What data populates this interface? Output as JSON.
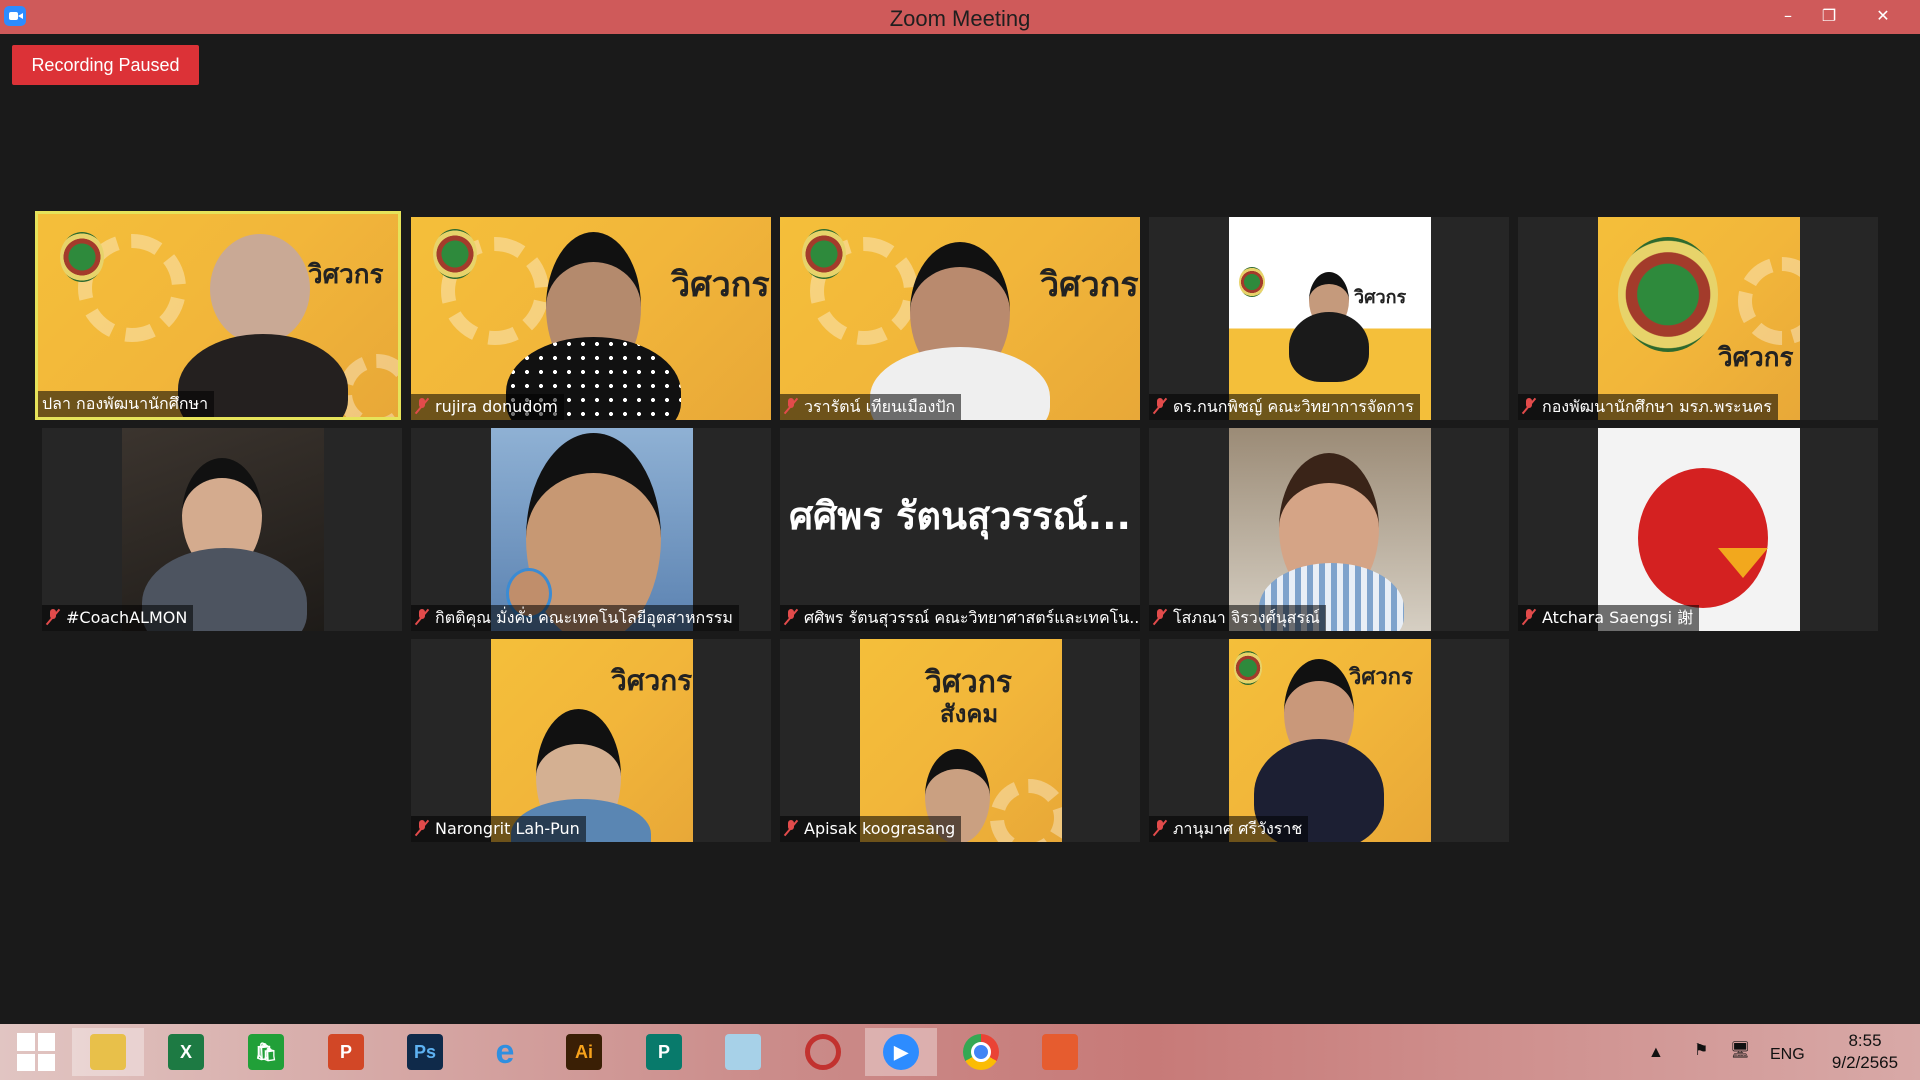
{
  "window": {
    "title": "Zoom Meeting",
    "minimize": "–",
    "restore": "❐",
    "close": "✕"
  },
  "recording": {
    "label": "Recording Paused"
  },
  "participants": [
    {
      "name": "ปลา กองพัฒนานักศึกษา",
      "muted": false,
      "active": true
    },
    {
      "name": "rujira donudom",
      "muted": true
    },
    {
      "name": "วรารัตน์ เทียนเมืองปัก",
      "muted": true
    },
    {
      "name": "ดร.กนกพิชญ์ คณะวิทยาการจัดการ",
      "muted": true
    },
    {
      "name": "กองพัฒนานักศึกษา มรภ.พระนคร",
      "muted": true
    },
    {
      "name": "#CoachALMON",
      "muted": true
    },
    {
      "name": "กิตติคุณ มั่งคั่ง คณะเทคโนโลยีอุตสาหกรรม",
      "muted": true
    },
    {
      "name": "ศศิพร รัตนสุวรรณ์ คณะวิทยาศาสตร์และเทคโน...",
      "muted": true,
      "avatar_text": "ศศิพร รัตนสุวรรณ์..."
    },
    {
      "name": "โสภณา จิรวงศ์นุสรณ์",
      "muted": true
    },
    {
      "name": "Atchara Saengsi 謝",
      "muted": true
    },
    {
      "name": "Narongrit Lah-Pun",
      "muted": true
    },
    {
      "name": "Apisak koograsang",
      "muted": true
    },
    {
      "name": "ภานุมาศ ศรีวังราช",
      "muted": true
    }
  ],
  "poster": {
    "title_line1": "วิศวกร",
    "title_line2": "สังคม"
  },
  "taskbar": {
    "apps": [
      "windows-start",
      "file-explorer",
      "excel",
      "store",
      "powerpoint",
      "photoshop",
      "internet-explorer",
      "illustrator",
      "publisher",
      "notepad",
      "photoscape",
      "zoom",
      "chrome",
      "office"
    ],
    "excel": "X",
    "store": "🛍",
    "powerpoint": "P",
    "photoshop": "Ps",
    "ie": "e",
    "illustrator": "Ai",
    "publisher": "P",
    "tray_language": "ENG",
    "time": "8:55",
    "date": "9/2/2565"
  }
}
